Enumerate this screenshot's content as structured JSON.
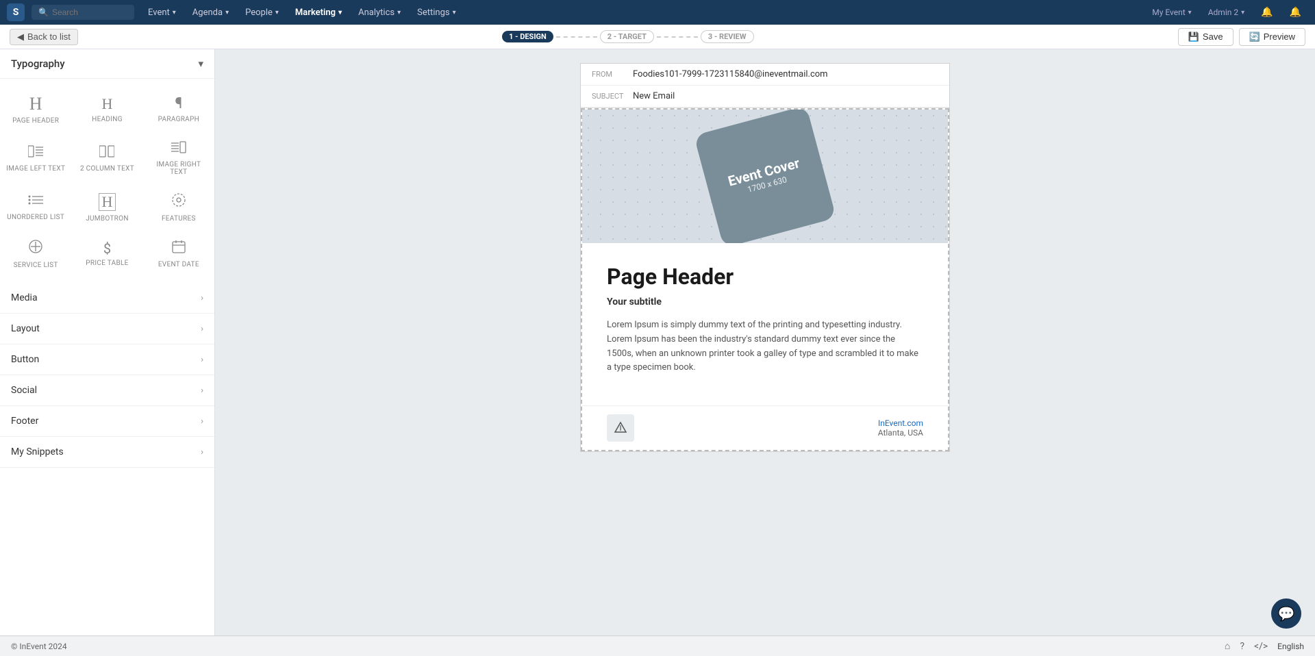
{
  "topnav": {
    "logo": "S",
    "search_placeholder": "Search",
    "items": [
      {
        "label": "Event",
        "has_chevron": true
      },
      {
        "label": "Agenda",
        "has_chevron": true
      },
      {
        "label": "People",
        "has_chevron": true
      },
      {
        "label": "Marketing",
        "has_chevron": true,
        "active": true
      },
      {
        "label": "Analytics",
        "has_chevron": true
      },
      {
        "label": "Settings",
        "has_chevron": true
      }
    ],
    "right_items": [
      {
        "label": "My Event",
        "has_chevron": true
      },
      {
        "label": "Admin 2",
        "has_chevron": true
      }
    ]
  },
  "subheader": {
    "back_label": "Back to list",
    "steps": [
      {
        "label": "1 - DESIGN",
        "active": true
      },
      {
        "label": "2 - TARGET",
        "active": false
      },
      {
        "label": "3 - REVIEW",
        "active": false
      }
    ],
    "save_label": "Save",
    "preview_label": "Preview"
  },
  "sidebar": {
    "typography_label": "Typography",
    "typography_items": [
      {
        "icon": "H",
        "label": "PAGE HEADER",
        "style": "page-header"
      },
      {
        "icon": "H",
        "label": "HEADING",
        "style": "heading"
      },
      {
        "icon": "¶",
        "label": "PARAGRAPH",
        "style": "paragraph"
      },
      {
        "icon": "≡",
        "label": "IMAGE LEFT TEXT",
        "style": "image-left"
      },
      {
        "icon": "▣",
        "label": "2 COLUMN TEXT",
        "style": "two-col"
      },
      {
        "icon": "≡",
        "label": "IMAGE RIGHT TEXT",
        "style": "image-right"
      },
      {
        "icon": "≡",
        "label": "UNORDERED LIST",
        "style": "list"
      },
      {
        "icon": "H",
        "label": "JUMBOTRON",
        "style": "jumbotron"
      },
      {
        "icon": "◎",
        "label": "FEATURES",
        "style": "features"
      },
      {
        "icon": "◉",
        "label": "SERVICE LIST",
        "style": "service"
      },
      {
        "icon": "$",
        "label": "PRICE TABLE",
        "style": "price"
      },
      {
        "icon": "▦",
        "label": "EVENT DATE",
        "style": "event-date"
      }
    ],
    "sections": [
      {
        "label": "Media"
      },
      {
        "label": "Layout"
      },
      {
        "label": "Button"
      },
      {
        "label": "Social"
      },
      {
        "label": "Footer"
      },
      {
        "label": "My Snippets"
      }
    ]
  },
  "email": {
    "from_label": "FROM",
    "from_value": "Foodies101-7999-1723115840@ineventmail.com",
    "subject_label": "SUBJECT",
    "subject_value": "New Email",
    "cover": {
      "title": "Event Cover",
      "subtitle": "1700 x 630"
    },
    "page_header": "Page Header",
    "subtitle": "Your subtitle",
    "body_text": "Lorem Ipsum is simply dummy text of the printing and typesetting industry. Lorem Ipsum has been the industry's standard dummy text ever since the 1500s, when an unknown printer took a galley of type and scrambled it to make a type specimen book.",
    "footer_link": "InEvent.com",
    "footer_location": "Atlanta, USA"
  },
  "bottom_bar": {
    "copyright": "© InEvent 2024",
    "language": "English"
  }
}
